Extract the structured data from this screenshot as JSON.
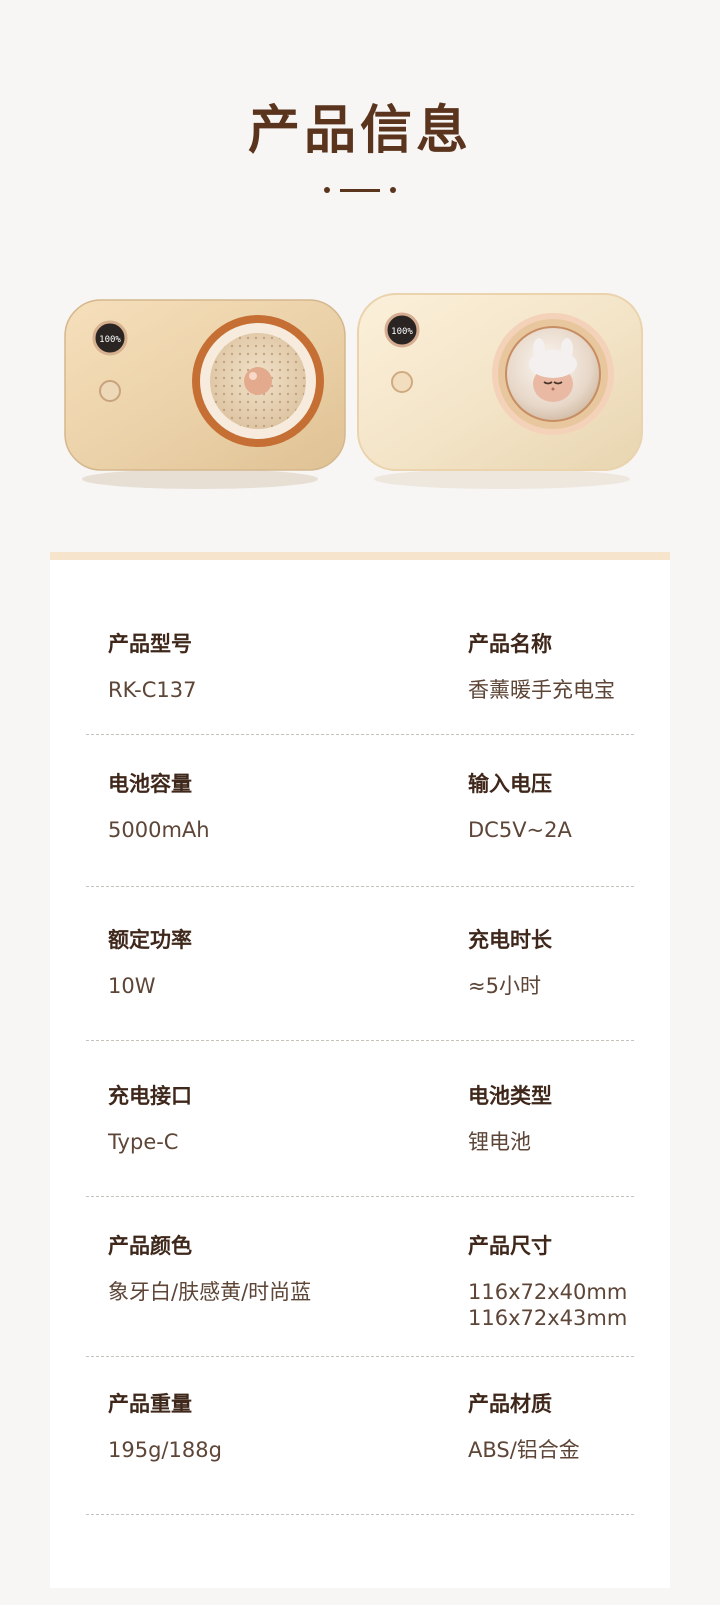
{
  "header": {
    "title": "产品信息"
  },
  "specs": [
    {
      "left": {
        "label": "产品型号",
        "value": "RK-C137"
      },
      "right": {
        "label": "产品名称",
        "value": "香薰暖手充电宝"
      }
    },
    {
      "left": {
        "label": "电池容量",
        "value": "5000mAh"
      },
      "right": {
        "label": "输入电压",
        "value": "DC5V~2A"
      }
    },
    {
      "left": {
        "label": "额定功率",
        "value": "10W"
      },
      "right": {
        "label": "充电时长",
        "value": "≈5小时"
      }
    },
    {
      "left": {
        "label": "充电接口",
        "value": "Type-C"
      },
      "right": {
        "label": "电池类型",
        "value": "锂电池"
      }
    },
    {
      "left": {
        "label": "产品颜色",
        "value": "象牙白/肤感黄/时尚蓝"
      },
      "right": {
        "label": "产品尺寸",
        "value": "116x72x40mm\n116x72x43mm"
      }
    },
    {
      "left": {
        "label": "产品重量",
        "value": "195g/188g"
      },
      "right": {
        "label": "产品材质",
        "value": "ABS/铝合金"
      }
    }
  ],
  "product_display": {
    "left_screen_text": "100%",
    "right_screen_text": "100%"
  }
}
